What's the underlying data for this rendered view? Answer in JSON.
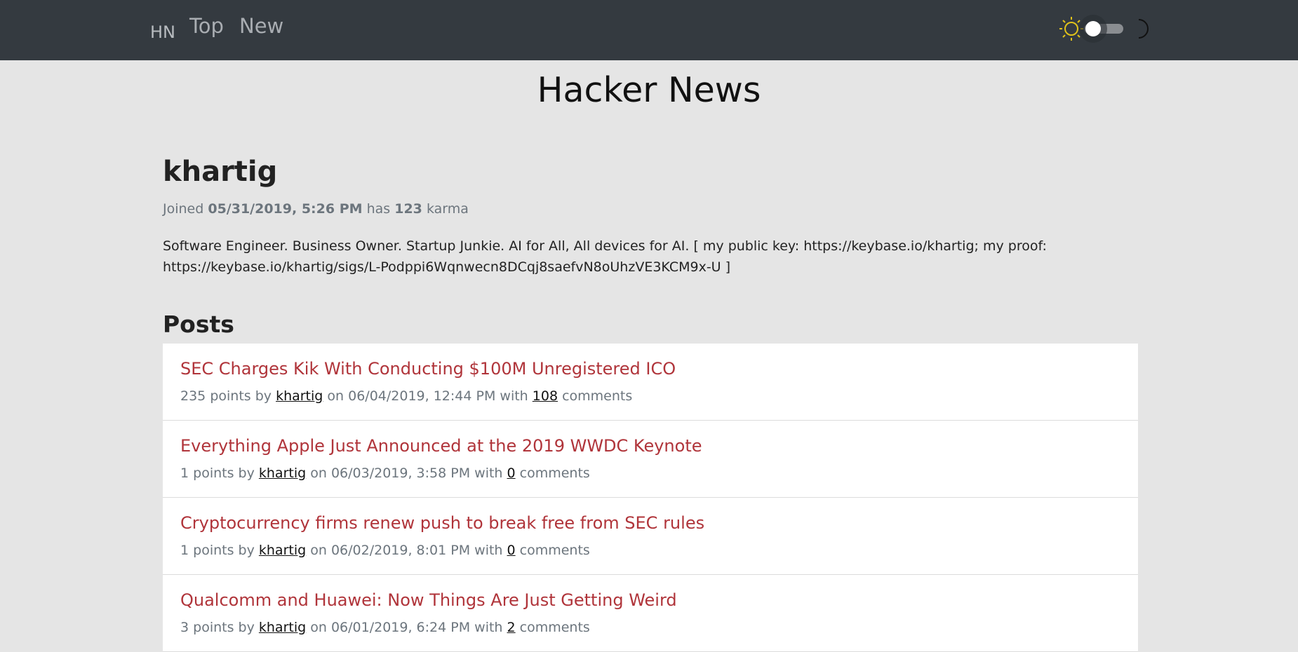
{
  "nav": {
    "logo": "HN",
    "links": [
      "Top",
      "New"
    ]
  },
  "theme_toggle": {
    "light_icon": "sun-icon",
    "dark_icon": "moon-icon",
    "state": "light",
    "sun_color": "#e0c21a"
  },
  "page_title": "Hacker News",
  "user": {
    "name": "khartig",
    "joined_prefix": "Joined",
    "joined_date": "05/31/2019, 5:26 PM",
    "has_text": "has",
    "karma": "123",
    "karma_text": "karma",
    "about": "Software Engineer. Business Owner. Startup Junkie. AI for All, All devices for AI. [ my public key: https://keybase.io/khartig; my proof: https://keybase.io/khartig/sigs/L-Podppi6Wqnwecn8DCqj8saefvN8oUhzVE3KCM9x-U ]"
  },
  "posts_title": "Posts",
  "meta_words": {
    "points": "points by",
    "on": "on",
    "with": "with",
    "comments": "comments"
  },
  "posts": [
    {
      "title": "SEC Charges Kik With Conducting $100M Unregistered ICO",
      "points": "235",
      "author": "khartig",
      "date": "06/04/2019, 12:44 PM",
      "comments": "108"
    },
    {
      "title": "Everything Apple Just Announced at the 2019 WWDC Keynote",
      "points": "1",
      "author": "khartig",
      "date": "06/03/2019, 3:58 PM",
      "comments": "0"
    },
    {
      "title": "Cryptocurrency firms renew push to break free from SEC rules",
      "points": "1",
      "author": "khartig",
      "date": "06/02/2019, 8:01 PM",
      "comments": "0"
    },
    {
      "title": "Qualcomm and Huawei: Now Things Are Just Getting Weird",
      "points": "3",
      "author": "khartig",
      "date": "06/01/2019, 6:24 PM",
      "comments": "2"
    }
  ]
}
